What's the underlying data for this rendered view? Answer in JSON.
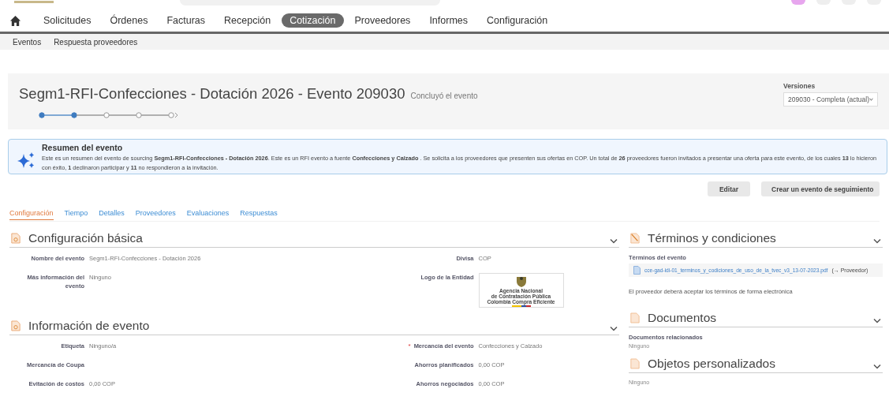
{
  "nav": {
    "items": [
      {
        "label": "Solicitudes",
        "selected": false
      },
      {
        "label": "Órdenes",
        "selected": false
      },
      {
        "label": "Facturas",
        "selected": false
      },
      {
        "label": "Recepción",
        "selected": false
      },
      {
        "label": "Cotización",
        "selected": true
      },
      {
        "label": "Proveedores",
        "selected": false
      },
      {
        "label": "Informes",
        "selected": false
      },
      {
        "label": "Configuración",
        "selected": false
      }
    ]
  },
  "subnav": [
    "Eventos",
    "Respuesta proveedores"
  ],
  "header": {
    "title": "Segm1-RFI-Confecciones - Dotación 2026 - Evento 209030",
    "status": "Concluyó el evento",
    "steps": [
      {
        "completed": true
      },
      {
        "completed": true
      },
      {
        "completed": false
      },
      {
        "completed": false
      },
      {
        "completed": false
      }
    ],
    "versions_label": "Versiones",
    "versions_value": "209030 - Completa (actual)"
  },
  "summary": {
    "title": "Resumen del evento",
    "text": "Este es un resumen del evento de sourcing **Segm1-RFI-Confecciones - Dotación 2026**. Este es un RFI evento a fuente **Confecciones y Calzado** . Se solicita a los proveedores que presenten sus ofertas en COP. Un total de **26** proveedores fueron invitados a presentar una oferta para este evento, de los cuales **13** lo hicieron con éxito, **1** declinaron participar y **11** no respondieron a la invitación."
  },
  "actions": [
    "Editar",
    "Crear un evento de seguimiento"
  ],
  "tabs": [
    {
      "label": "Configuración",
      "selected": true
    },
    {
      "label": "Tiempo",
      "selected": false
    },
    {
      "label": "Detalles",
      "selected": false
    },
    {
      "label": "Proveedores",
      "selected": false
    },
    {
      "label": "Evaluaciones",
      "selected": false
    },
    {
      "label": "Respuestas",
      "selected": false
    }
  ],
  "sections": [
    {
      "title": "Configuración básica",
      "left": [
        {
          "label": "Nombre del evento",
          "value": "Segm1-RFI-Confecciones - Dotación 2026"
        },
        {
          "label": "Más información del evento",
          "value": "Ninguno"
        }
      ],
      "right": [
        {
          "kind": "text",
          "label": "Divisa",
          "value": "COP"
        },
        {
          "kind": "logo",
          "label": "Logo de la Entidad",
          "lines": [
            "Agencia Nacional",
            "de Contratación Pública",
            "Colombia Compra Eficiente"
          ]
        }
      ]
    },
    {
      "title": "Información de evento",
      "left": [
        {
          "label": "Etiqueta",
          "value": "Ninguno/a"
        },
        {
          "label": "Mercancía de Coupa"
        },
        {
          "label": "Evitación de costos",
          "value": "0,00 COP"
        }
      ],
      "right": [
        {
          "kind": "text",
          "label": "Mercancía del evento",
          "value": "Confecciones y Calzado",
          "marker": "*"
        },
        {
          "kind": "text",
          "label": "Ahorros planificados",
          "value": "0,00 COP"
        },
        {
          "kind": "text",
          "label": "Ahorros negociados",
          "value": "0,00 COP"
        }
      ]
    }
  ],
  "side": [
    {
      "kind": "terms",
      "title": "Términos y condiciones",
      "label": "Términos del evento",
      "file": "cce-gad-idi-01_terminos_y_codiciones_de_uso_de_la_tvec_v3_13-07-2023.pdf",
      "file_note": "(→ Proveedor)",
      "note": "El proveedor deberá aceptar los términos de forma electrónica"
    },
    {
      "kind": "docs",
      "title": "Documentos",
      "label": "Documentos relacionados",
      "value": "Ninguno"
    },
    {
      "kind": "docs",
      "title": "Objetos personalizados",
      "value": "Ninguno"
    }
  ]
}
